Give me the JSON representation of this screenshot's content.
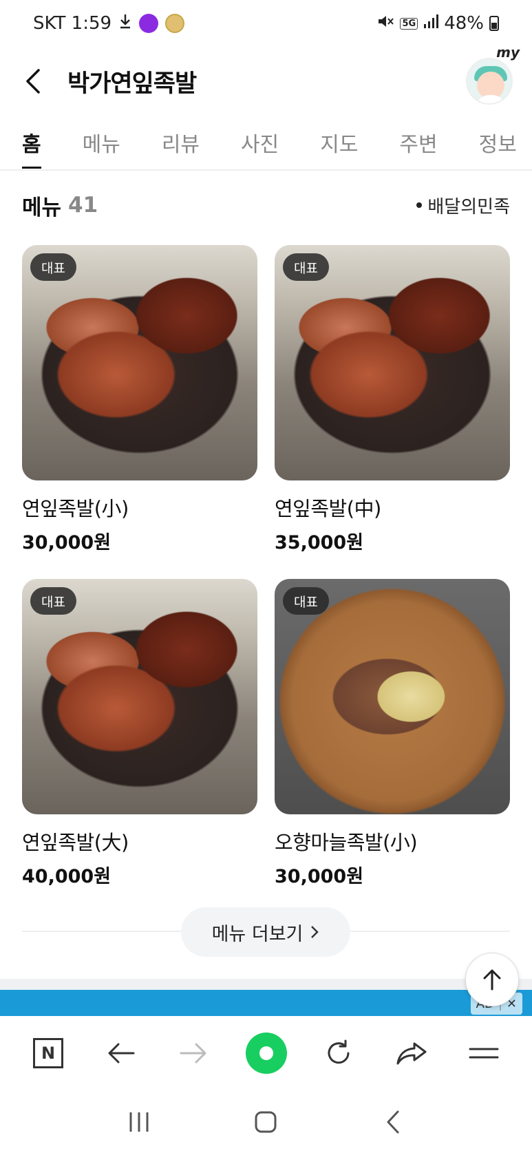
{
  "status_bar": {
    "carrier_time": "SKT 1:59",
    "network": "5G",
    "battery": "48%"
  },
  "header": {
    "title": "박가연잎족발",
    "avatar_label": "my"
  },
  "tabs": [
    {
      "label": "홈",
      "active": true
    },
    {
      "label": "메뉴",
      "active": false
    },
    {
      "label": "리뷰",
      "active": false
    },
    {
      "label": "사진",
      "active": false
    },
    {
      "label": "지도",
      "active": false
    },
    {
      "label": "주변",
      "active": false
    },
    {
      "label": "정보",
      "active": false
    }
  ],
  "menu_section": {
    "title": "메뉴",
    "count": "41",
    "source": "배달의민족"
  },
  "menu_items": [
    {
      "badge": "대표",
      "name": "연잎족발(小)",
      "price": "30,000원",
      "image": "jokbal-photo"
    },
    {
      "badge": "대표",
      "name": "연잎족발(中)",
      "price": "35,000원",
      "image": "jokbal-photo"
    },
    {
      "badge": "대표",
      "name": "연잎족발(大)",
      "price": "40,000원",
      "image": "jokbal-photo"
    },
    {
      "badge": "대표",
      "name": "오향마늘족발(小)",
      "price": "30,000원",
      "image": "garlic-jokbal-photo"
    }
  ],
  "more_button": {
    "label": "메뉴 더보기"
  },
  "ad": {
    "label": "AD",
    "close": "✕"
  },
  "colors": {
    "brand_green": "#19ce60",
    "ad_blue": "#1a9ad6",
    "badge_bg": "#282828"
  }
}
